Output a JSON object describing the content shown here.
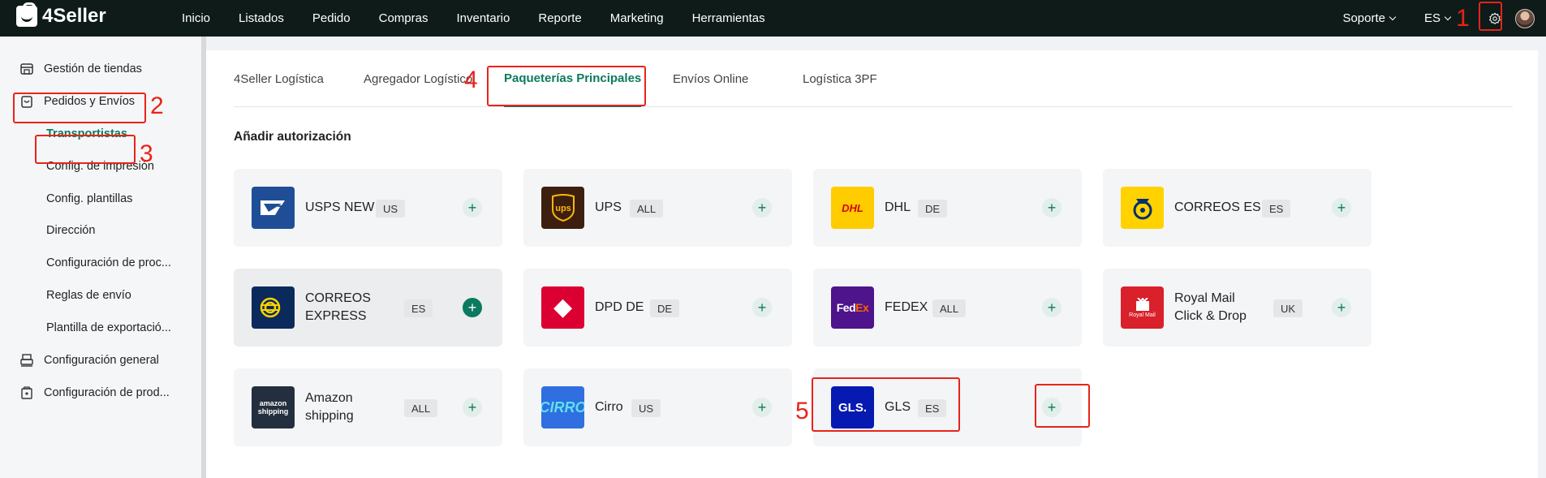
{
  "app": {
    "logo_text": "4Seller"
  },
  "nav": {
    "items": [
      "Inicio",
      "Listados",
      "Pedido",
      "Compras",
      "Inventario",
      "Reporte",
      "Marketing",
      "Herramientas"
    ],
    "support_label": "Soporte",
    "language_label": "ES"
  },
  "sidebar": {
    "items": [
      {
        "label": "Gestión de tiendas",
        "icon": "store-icon"
      },
      {
        "label": "Pedidos y Envíos",
        "icon": "bag-icon"
      },
      {
        "label": "Configuración general",
        "icon": "printer-icon"
      },
      {
        "label": "Configuración de prod...",
        "icon": "box-icon"
      }
    ],
    "sub_items": [
      "Transportistas",
      "Config. de impresión",
      "Config. plantillas",
      "Dirección",
      "Configuración de proc...",
      "Reglas de envío",
      "Plantilla de exportació..."
    ]
  },
  "tabs": [
    "4Seller Logística",
    "Agregador Logístico",
    "Paqueterías Principales",
    "Envíos Online",
    "Logística 3PF"
  ],
  "section_title": "Añadir autorización",
  "carriers": [
    {
      "name": "USPS NEW",
      "region": "US"
    },
    {
      "name": "UPS",
      "region": "ALL"
    },
    {
      "name": "DHL",
      "region": "DE"
    },
    {
      "name": "CORREOS ES",
      "region": "ES"
    },
    {
      "name": "CORREOS EXPRESS",
      "region": "ES"
    },
    {
      "name": "DPD DE",
      "region": "DE"
    },
    {
      "name": "FEDEX",
      "region": "ALL"
    },
    {
      "name": "Royal Mail Click & Drop",
      "region": "UK"
    },
    {
      "name": "Amazon shipping",
      "region": "ALL"
    },
    {
      "name": "Cirro",
      "region": "US"
    },
    {
      "name": "GLS",
      "region": "ES"
    }
  ],
  "logo_text": {
    "ups": "ups",
    "dhl": "DHL",
    "dpd_glyph": "◆",
    "fedex_fed": "Fed",
    "fedex_ex": "Ex",
    "royalmail": "Royal Mail",
    "amazon": "amazon shipping",
    "cirro": "CIRRO",
    "gls": "GLS."
  },
  "annotations": [
    "1",
    "2",
    "3",
    "4",
    "5"
  ],
  "colors": {
    "accent": "#0b7a5e",
    "topbar": "#0e1b19",
    "annotation": "#e8231a"
  }
}
